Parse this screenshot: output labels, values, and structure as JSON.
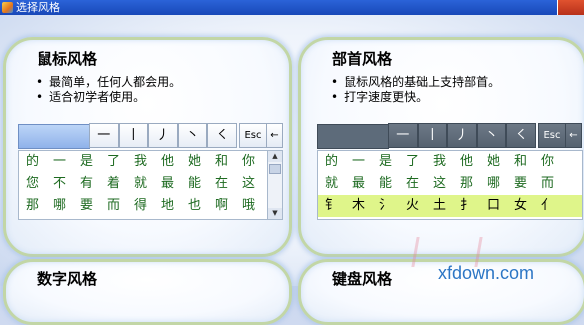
{
  "window": {
    "title": "选择风格"
  },
  "panels": {
    "mouse": {
      "title": "鼠标风格",
      "desc": [
        "最简单，任何人都会用。",
        "适合初学者使用。"
      ],
      "strokes": [
        "一",
        "丨",
        "丿",
        "丶",
        "㇛"
      ],
      "esc": "Esc",
      "back": "←",
      "rows": [
        [
          "的",
          "一",
          "是",
          "了",
          "我",
          "他",
          "她",
          "和",
          "你"
        ],
        [
          "您",
          "不",
          "有",
          "着",
          "就",
          "最",
          "能",
          "在",
          "这"
        ],
        [
          "那",
          "哪",
          "要",
          "而",
          "得",
          "地",
          "也",
          "啊",
          "哦"
        ]
      ]
    },
    "radical": {
      "title": "部首风格",
      "desc": [
        "鼠标风格的基础上支持部首。",
        "打字速度更快。"
      ],
      "strokes": [
        "一",
        "丨",
        "丿",
        "丶",
        "㇛"
      ],
      "esc": "Esc",
      "back": "←",
      "rows": [
        [
          "的",
          "一",
          "是",
          "了",
          "我",
          "他",
          "她",
          "和",
          "你"
        ],
        [
          "就",
          "最",
          "能",
          "在",
          "这",
          "那",
          "哪",
          "要",
          "而"
        ],
        [
          "钅",
          "木",
          "氵",
          "火",
          "土",
          "扌",
          "口",
          "女",
          "亻"
        ]
      ]
    },
    "number": {
      "title": "数字风格"
    },
    "keyboard": {
      "title": "键盘风格"
    }
  },
  "watermark": "xfdown.com",
  "icons": {
    "app": "app-icon",
    "close": "close-icon",
    "scroll_up": "scroll-up-icon",
    "scroll_down": "scroll-down-icon"
  },
  "colors": {
    "accent": "#2b63d8",
    "panel_border": "#c2d6a6",
    "char_green": "#1d6a20",
    "highlight": "#dff58a"
  }
}
